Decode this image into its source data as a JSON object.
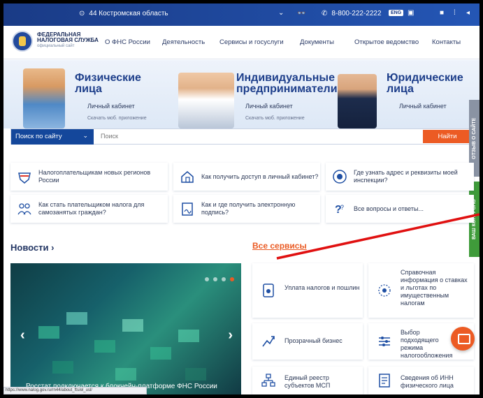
{
  "topbar": {
    "region": "44 Костромская область",
    "phone": "8-800-222-2222",
    "lang": "ENG"
  },
  "header": {
    "logo_line1": "ФЕДЕРАЛЬНАЯ",
    "logo_line2": "НАЛОГОВАЯ СЛУЖБА",
    "logo_sub": "официальный сайт",
    "nav": [
      "О ФНС России",
      "Деятельность",
      "Сервисы и госуслуги",
      "Документы",
      "Открытое ведомство",
      "Контакты"
    ]
  },
  "hero": {
    "groups": [
      {
        "title": "Физические лица",
        "cabinet": "Личный кабинет",
        "app": "Скачать моб. приложение"
      },
      {
        "title": "Индивидуальные предприниматели",
        "cabinet": "Личный кабинет",
        "app": "Скачать моб. приложение"
      },
      {
        "title": "Юридические лица",
        "cabinet": "Личный кабинет"
      }
    ]
  },
  "search": {
    "scope": "Поиск по сайту",
    "placeholder": "Поиск",
    "button": "Найти"
  },
  "sidetabs": {
    "feedback": "ОТЗЫВ О САЙТЕ",
    "control": "ВАШ КОНТРОЛЬ"
  },
  "quick_links": [
    "Налогоплательщикам новых регионов России",
    "Как получить доступ в личный кабинет?",
    "Где узнать адрес и реквизиты моей инспекции?",
    "Как стать плательщиком налога для самозанятых граждан?",
    "Как и где получить электронную подпись?",
    "Все вопросы и ответы..."
  ],
  "news": {
    "title": "Новости",
    "caption": "Росстат подключается к блокчейн-платформе ФНС России"
  },
  "services": {
    "title": "Все сервисы",
    "items": [
      "Уплата налогов и пошлин",
      "Справочная информация о ставках и льготах по имущественным налогам",
      "Прозрачный бизнес",
      "Выбор подходящего режима налогообложения",
      "Единый реестр субъектов МСП",
      "Сведения об ИНН физического лица"
    ]
  },
  "statusbar": {
    "url": "https://www.nalog.gov.ru/rn44/about_fts/el_usl/"
  },
  "colors": {
    "brand_blue": "#14479b",
    "accent_orange": "#ec5b24",
    "annotation_red": "#e01010"
  }
}
